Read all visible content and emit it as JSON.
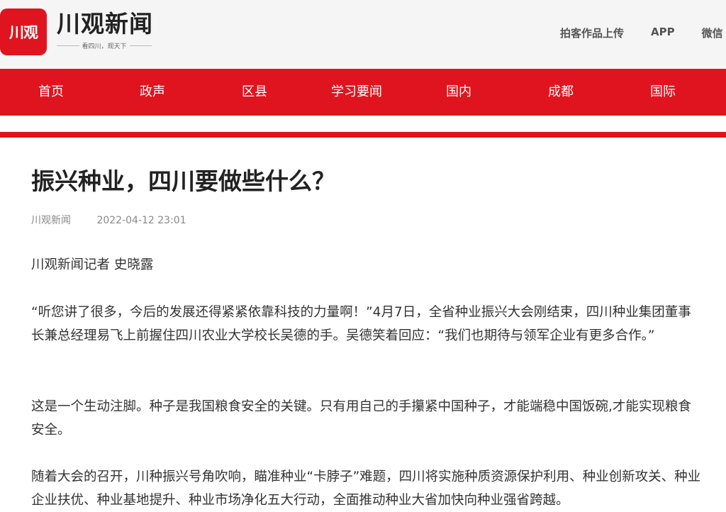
{
  "header": {
    "logo_icon_text": "川观",
    "logo_title": "川观新闻",
    "slogan": "看四川，观天下",
    "links": [
      "拍客作品上传",
      "APP",
      "微信"
    ]
  },
  "nav": {
    "items": [
      "首页",
      "政声",
      "区县",
      "学习要闻",
      "国内",
      "成都",
      "国际"
    ]
  },
  "article": {
    "title": "振兴种业，四川要做些什么？",
    "source": "川观新闻",
    "date": "2022-04-12 23:01",
    "paragraphs": [
      "川观新闻记者 史晓露",
      "“听您讲了很多，今后的发展还得紧紧依靠科技的力量啊！”4月7日，全省种业振兴大会刚结束，四川种业集团董事长兼总经理易飞上前握住四川农业大学校长吴德的手。吴德笑着回应：“我们也期待与领军企业有更多合作。”",
      "这是一个生动注脚。种子是我国粮食安全的关键。只有用自己的手攥紧中国种子，才能端稳中国饭碗,才能实现粮食安全。",
      "随着大会的召开，川种振兴号角吹响，瞄准种业“卡脖子”难题，四川将实施种质资源保护利用、种业创新攻关、种业企业扶优、种业基地提升、种业市场净化五大行动，全面推动种业大省加快向种业强省跨越。"
    ]
  },
  "colors": {
    "brand_red": "#e0141e",
    "header_bg": "#f5f5f5"
  }
}
